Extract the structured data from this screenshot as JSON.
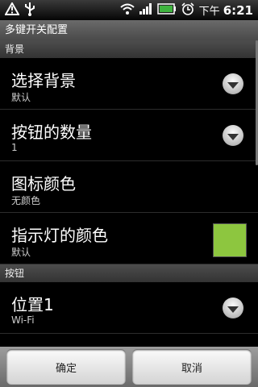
{
  "status_bar": {
    "time_prefix": "下午",
    "time": "6:21",
    "icons": [
      "warning-icon",
      "usb-icon",
      "wifi-icon",
      "signal-icon",
      "battery-icon",
      "alarm-icon"
    ]
  },
  "title": "多键开关配置",
  "sections": [
    {
      "header": "背景",
      "items": [
        {
          "title": "选择背景",
          "summary": "默认",
          "widget": "dropdown"
        },
        {
          "title": "按钮的数量",
          "summary": "1",
          "widget": "dropdown"
        },
        {
          "title": "图标颜色",
          "summary": "无颜色",
          "widget": "none"
        },
        {
          "title": "指示灯的颜色",
          "summary": "默认",
          "widget": "color",
          "color": "#8dc63f"
        }
      ]
    },
    {
      "header": "按钮",
      "items": [
        {
          "title": "位置1",
          "summary": "Wi-Fi",
          "widget": "dropdown"
        }
      ]
    }
  ],
  "buttons": {
    "ok": "确定",
    "cancel": "取消"
  }
}
